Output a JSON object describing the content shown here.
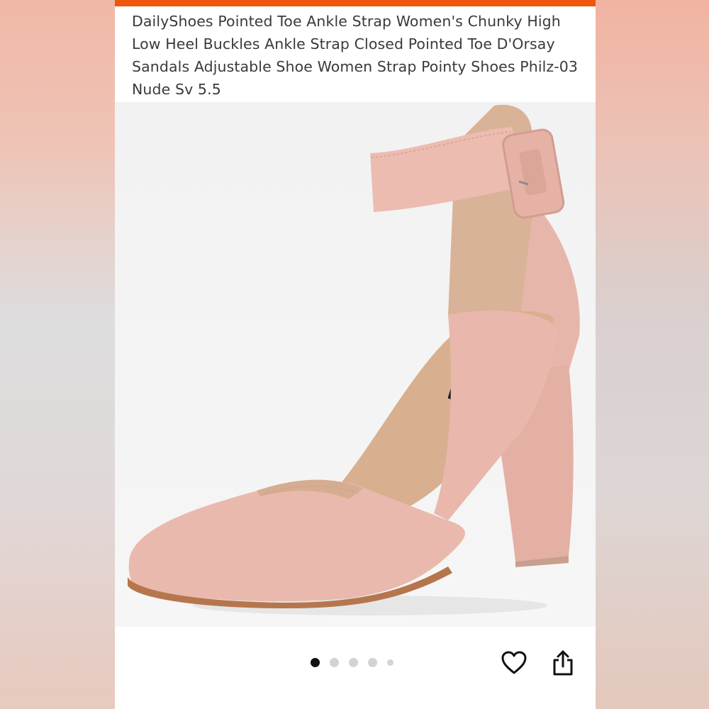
{
  "product": {
    "title": "DailyShoes Pointed Toe Ankle Strap Women's Chunky High Low Heel Buckles Ankle Strap Closed Pointed Toe D'Orsay Sandals Adjustable Shoe Women Strap Pointy Shoes Philz-03 Nude Sv 5.5"
  },
  "gallery": {
    "image_count": 5,
    "current_index": 1
  },
  "icons": {
    "favorite": "heart-icon",
    "share": "share-icon"
  },
  "colors": {
    "accent": "#f0560b",
    "shoe_suede": "#e9b8ae",
    "active_dot": "#111111",
    "inactive_dot": "#d3d3d3"
  }
}
